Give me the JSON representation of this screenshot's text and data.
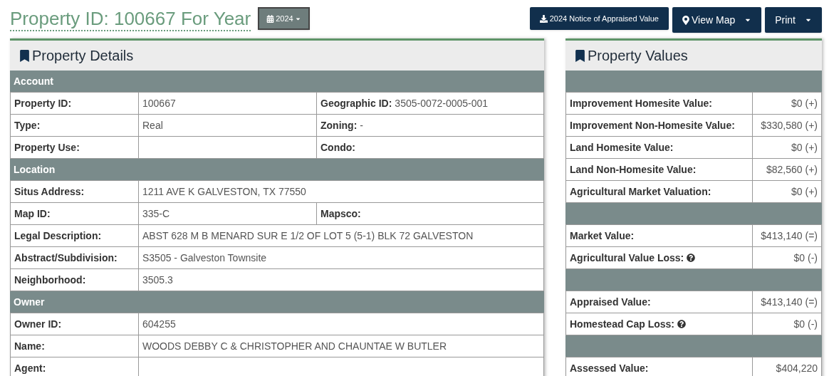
{
  "header": {
    "title": "Property ID: 100667 For Year",
    "year_button": "2024",
    "buttons": [
      {
        "kind": "download",
        "label": "2024 Notice of Appraised Value",
        "caret": false
      },
      {
        "kind": "map",
        "label": "View Map",
        "caret": true
      },
      {
        "kind": "plain",
        "label": "Print",
        "caret": true
      }
    ]
  },
  "property_details": {
    "title": "Property Details",
    "sections": [
      {
        "title": "Account",
        "rows": [
          {
            "label": "Property ID:",
            "value": "100667",
            "extra": {
              "label": "Geographic ID:",
              "value": "3505-0072-0005-001"
            }
          },
          {
            "label": "Type:",
            "value": "Real",
            "extra": {
              "label": "Zoning:",
              "value": "-"
            }
          },
          {
            "label": "Property Use:",
            "extra": {
              "label": "Condo:"
            }
          }
        ]
      },
      {
        "title": "Location",
        "rows": [
          {
            "label": "Situs Address:",
            "value": "1211 AVE K GALVESTON, TX 77550"
          },
          {
            "label": "Map ID:",
            "value": "335-C",
            "extra": {
              "label": "Mapsco:"
            }
          },
          {
            "label": "Legal Description:",
            "value": "ABST 628 M B MENARD SUR E 1/2 OF LOT 5 (5-1) BLK 72 GALVESTON"
          },
          {
            "label": "Abstract/Subdivision:",
            "value": "S3505 - Galveston Townsite"
          },
          {
            "label": "Neighborhood:",
            "value": "3505.3"
          }
        ]
      },
      {
        "title": "Owner",
        "rows": [
          {
            "label": "Owner ID:",
            "value": "604255"
          },
          {
            "label": "Name:",
            "value": "WOODS DEBBY C & CHRISTOPHER AND CHAUNTAE W BUTLER"
          },
          {
            "label": "Agent:"
          }
        ]
      }
    ]
  },
  "property_values": {
    "title": "Property Values",
    "rows": [
      {
        "kind": "spacer"
      },
      {
        "kind": "value",
        "label": "Improvement Homesite Value:",
        "value": "$0 (+)",
        "help": false
      },
      {
        "kind": "value",
        "label": "Improvement Non-Homesite Value:",
        "value": "$330,580 (+)",
        "help": false
      },
      {
        "kind": "value",
        "label": "Land Homesite Value:",
        "value": "$0 (+)",
        "help": false
      },
      {
        "kind": "value",
        "label": "Land Non-Homesite Value:",
        "value": "$82,560 (+)",
        "help": false
      },
      {
        "kind": "value",
        "label": "Agricultural Market Valuation:",
        "value": "$0 (+)",
        "help": false
      },
      {
        "kind": "spacer"
      },
      {
        "kind": "value",
        "label": "Market Value:",
        "value": "$413,140 (=)",
        "help": false
      },
      {
        "kind": "value",
        "label": "Agricultural Value Loss:",
        "value": "$0 (-)",
        "help": true
      },
      {
        "kind": "spacer"
      },
      {
        "kind": "value",
        "label": "Appraised Value:",
        "value": "$413,140 (=)",
        "help": false
      },
      {
        "kind": "value",
        "label": "Homestead Cap Loss:",
        "value": "$0 (-)",
        "help": true
      },
      {
        "kind": "spacer"
      },
      {
        "kind": "value",
        "label": "Assessed Value:",
        "value": "$404,220",
        "help": false
      }
    ]
  }
}
